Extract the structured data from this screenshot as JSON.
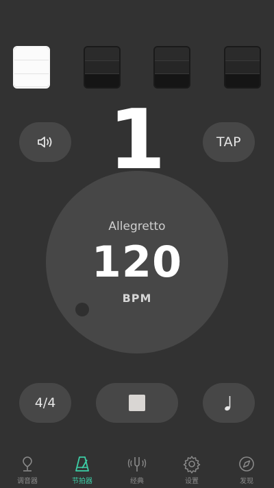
{
  "beats": [
    {
      "state": "active"
    },
    {
      "state": "inactive"
    },
    {
      "state": "inactive"
    },
    {
      "state": "inactive"
    }
  ],
  "current_beat": "1",
  "controls": {
    "sound_icon": "speaker-icon",
    "tap_label": "TAP",
    "time_signature": "4/4",
    "start_stop_icon": "stop-icon",
    "note_icon": "quarter-note-icon"
  },
  "dial": {
    "tempo_name": "Allegretto",
    "bpm": "120",
    "unit": "BPM"
  },
  "tabs": [
    {
      "label": "调音器",
      "icon": "tuner-icon"
    },
    {
      "label": "节拍器",
      "icon": "metronome-icon",
      "active": true
    },
    {
      "label": "经典",
      "icon": "tuning-fork-icon"
    },
    {
      "label": "设置",
      "icon": "gear-icon"
    },
    {
      "label": "发现",
      "icon": "compass-icon"
    }
  ],
  "colors": {
    "background": "#323232",
    "button": "#474747",
    "accent": "#3ccfa7",
    "inactive_tab": "#8a8a8a"
  }
}
